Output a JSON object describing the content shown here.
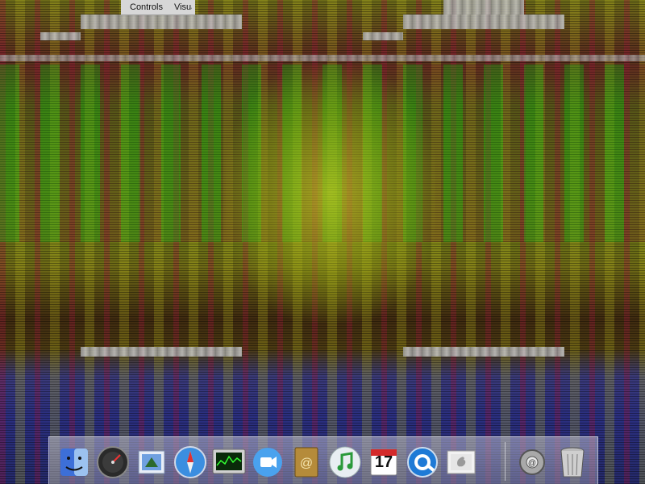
{
  "menubar": {
    "items": [
      {
        "label": "Controls"
      },
      {
        "label": "Visua"
      }
    ]
  },
  "dock": {
    "items": [
      {
        "name": "Finder",
        "icon": "finder-icon"
      },
      {
        "name": "Dashboard",
        "icon": "dashboard-icon"
      },
      {
        "name": "Mail",
        "icon": "mail-icon"
      },
      {
        "name": "Safari",
        "icon": "safari-icon"
      },
      {
        "name": "Activity Monitor",
        "icon": "activity-monitor-icon"
      },
      {
        "name": "iChat",
        "icon": "ichat-icon"
      },
      {
        "name": "Address Book",
        "icon": "address-book-icon"
      },
      {
        "name": "iTunes",
        "icon": "itunes-icon"
      },
      {
        "name": "iCal",
        "icon": "ical-icon",
        "label": "17"
      },
      {
        "name": "QuickTime Player",
        "icon": "quicktime-icon"
      },
      {
        "name": "Preview",
        "icon": "preview-icon"
      },
      {
        "name": "System Preferences",
        "icon": "system-preferences-icon"
      },
      {
        "name": "Trash",
        "icon": "trash-icon"
      }
    ]
  },
  "colors": {
    "dock_bg": "#b4b4cc",
    "menubar_bg": "#d7d7d7"
  }
}
